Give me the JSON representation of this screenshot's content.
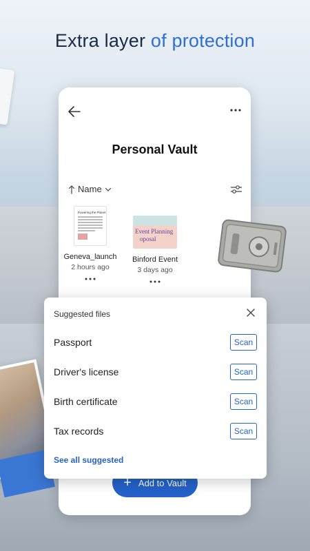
{
  "headline": {
    "part1": "Extra layer ",
    "part2": "of protection"
  },
  "vault": {
    "title": "Personal Vault",
    "sort_label": "Name",
    "files": [
      {
        "name": "Geneva_launch",
        "time": "2 hours ago",
        "thumb_heading": "Powering the Planet"
      },
      {
        "name": "Binford Event",
        "time": "3 days ago",
        "thumb_line1": "Event Planning",
        "thumb_line2": "oposal"
      }
    ],
    "add_button": "Add to Vault"
  },
  "suggested": {
    "title": "Suggested files",
    "items": [
      {
        "label": "Passport",
        "action": "Scan"
      },
      {
        "label": "Driver's license",
        "action": "Scan"
      },
      {
        "label": "Birth certificate",
        "action": "Scan"
      },
      {
        "label": "Tax records",
        "action": "Scan"
      }
    ],
    "see_all": "See all suggested"
  },
  "colors": {
    "accent": "#2462c9",
    "headline_dark": "#1b2a4a",
    "headline_blue": "#2f6ed6"
  },
  "icons": [
    "back-arrow-icon",
    "more-options-icon",
    "sort-arrow-icon",
    "chevron-down-icon",
    "filter-sliders-icon",
    "close-icon",
    "plus-icon",
    "safe-icon"
  ]
}
